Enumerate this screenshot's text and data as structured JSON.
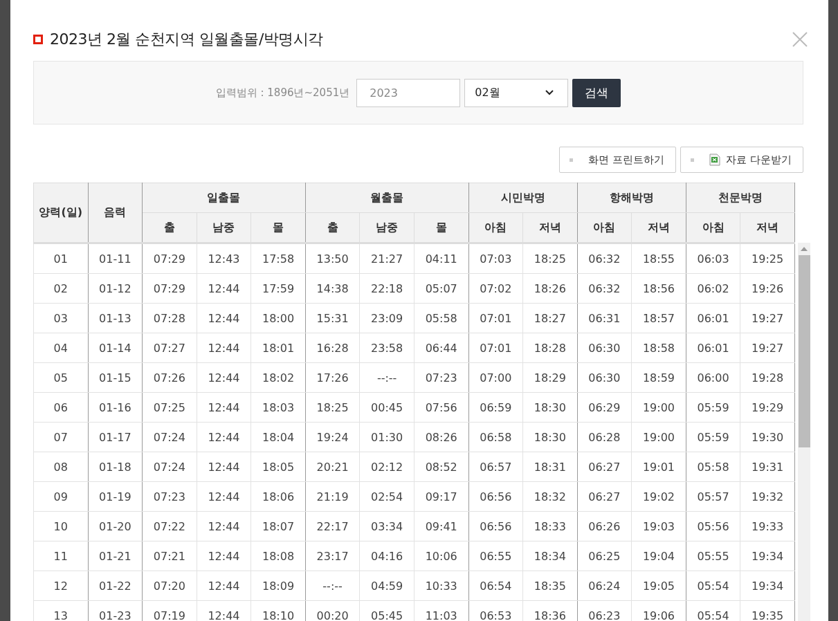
{
  "title": "2023년 2월 순천지역 일월출몰/박명시각",
  "search": {
    "range_label": "입력범위 : 1896년~2051년",
    "year": "2023",
    "month": "02월",
    "button": "검색"
  },
  "actions": [
    {
      "kind": "print",
      "label": "화면 프린트하기"
    },
    {
      "kind": "download",
      "label": "자료 다운받기"
    }
  ],
  "table": {
    "columns": [
      {
        "label": "양력(일)"
      },
      {
        "label": "음력"
      },
      {
        "label": "일출몰",
        "colspan": 3,
        "children": [
          {
            "label": "출"
          },
          {
            "label": "남중"
          },
          {
            "label": "몰"
          }
        ]
      },
      {
        "label": "월출몰",
        "colspan": 3,
        "children": [
          {
            "label": "출"
          },
          {
            "label": "남중"
          },
          {
            "label": "몰"
          }
        ]
      },
      {
        "label": "시민박명",
        "colspan": 2,
        "children": [
          {
            "label": "아침"
          },
          {
            "label": "저녁"
          }
        ]
      },
      {
        "label": "항해박명",
        "colspan": 2,
        "children": [
          {
            "label": "아침"
          },
          {
            "label": "저녁"
          }
        ]
      },
      {
        "label": "천문박명",
        "colspan": 2,
        "children": [
          {
            "label": "아침"
          },
          {
            "label": "저녁"
          }
        ]
      }
    ],
    "rows": [
      [
        "01",
        "01-11",
        "07:29",
        "12:43",
        "17:58",
        "13:50",
        "21:27",
        "04:11",
        "07:03",
        "18:25",
        "06:32",
        "18:55",
        "06:03",
        "19:25"
      ],
      [
        "02",
        "01-12",
        "07:29",
        "12:44",
        "17:59",
        "14:38",
        "22:18",
        "05:07",
        "07:02",
        "18:26",
        "06:32",
        "18:56",
        "06:02",
        "19:26"
      ],
      [
        "03",
        "01-13",
        "07:28",
        "12:44",
        "18:00",
        "15:31",
        "23:09",
        "05:58",
        "07:01",
        "18:27",
        "06:31",
        "18:57",
        "06:01",
        "19:27"
      ],
      [
        "04",
        "01-14",
        "07:27",
        "12:44",
        "18:01",
        "16:28",
        "23:58",
        "06:44",
        "07:01",
        "18:28",
        "06:30",
        "18:58",
        "06:01",
        "19:27"
      ],
      [
        "05",
        "01-15",
        "07:26",
        "12:44",
        "18:02",
        "17:26",
        "--:--",
        "07:23",
        "07:00",
        "18:29",
        "06:30",
        "18:59",
        "06:00",
        "19:28"
      ],
      [
        "06",
        "01-16",
        "07:25",
        "12:44",
        "18:03",
        "18:25",
        "00:45",
        "07:56",
        "06:59",
        "18:30",
        "06:29",
        "19:00",
        "05:59",
        "19:29"
      ],
      [
        "07",
        "01-17",
        "07:24",
        "12:44",
        "18:04",
        "19:24",
        "01:30",
        "08:26",
        "06:58",
        "18:30",
        "06:28",
        "19:00",
        "05:59",
        "19:30"
      ],
      [
        "08",
        "01-18",
        "07:24",
        "12:44",
        "18:05",
        "20:21",
        "02:12",
        "08:52",
        "06:57",
        "18:31",
        "06:27",
        "19:01",
        "05:58",
        "19:31"
      ],
      [
        "09",
        "01-19",
        "07:23",
        "12:44",
        "18:06",
        "21:19",
        "02:54",
        "09:17",
        "06:56",
        "18:32",
        "06:27",
        "19:02",
        "05:57",
        "19:32"
      ],
      [
        "10",
        "01-20",
        "07:22",
        "12:44",
        "18:07",
        "22:17",
        "03:34",
        "09:41",
        "06:56",
        "18:33",
        "06:26",
        "19:03",
        "05:56",
        "19:33"
      ],
      [
        "11",
        "01-21",
        "07:21",
        "12:44",
        "18:08",
        "23:17",
        "04:16",
        "10:06",
        "06:55",
        "18:34",
        "06:25",
        "19:04",
        "05:55",
        "19:34"
      ],
      [
        "12",
        "01-22",
        "07:20",
        "12:44",
        "18:09",
        "--:--",
        "04:59",
        "10:33",
        "06:54",
        "18:35",
        "06:24",
        "19:05",
        "05:54",
        "19:34"
      ],
      [
        "13",
        "01-23",
        "07:19",
        "12:44",
        "18:10",
        "00:20",
        "05:45",
        "11:03",
        "06:53",
        "18:36",
        "06:23",
        "19:06",
        "05:54",
        "19:35"
      ]
    ]
  }
}
